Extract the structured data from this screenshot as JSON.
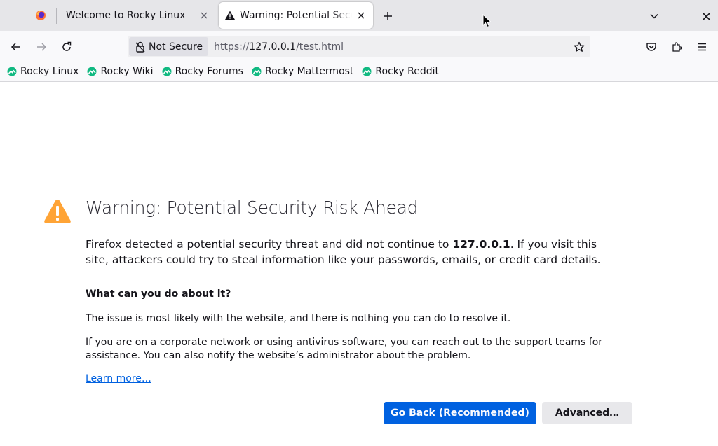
{
  "tabs": [
    {
      "label": "Welcome to Rocky Linux",
      "active": false
    },
    {
      "label": "Warning: Potential Security Risk Ahead",
      "active": true
    }
  ],
  "icons": {
    "firefox": "firefox-view-icon",
    "close": "close-icon",
    "new_tab": "plus-icon",
    "tab_list": "chevron-down-icon",
    "back": "back-arrow-icon",
    "forward": "forward-arrow-icon",
    "reload": "reload-icon",
    "lock": "broken-lock-icon",
    "star": "star-icon",
    "pocket": "pocket-icon",
    "extensions": "puzzle-icon",
    "menu": "hamburger-menu-icon",
    "warning": "warning-triangle-icon"
  },
  "urlbar": {
    "security_label": "Not Secure",
    "url_prefix": "https://",
    "url_host": "127.0.0.1",
    "url_path": "/test.html"
  },
  "bookmarks": [
    "Rocky Linux",
    "Rocky Wiki",
    "Rocky Forums",
    "Rocky Mattermost",
    "Rocky Reddit"
  ],
  "page": {
    "title": "Warning: Potential Security Risk Ahead",
    "desc_before": "Firefox detected a potential security threat and did not continue to ",
    "desc_host": "127.0.0.1",
    "desc_after": ". If you visit this site, attackers could try to steal information like your passwords, emails, or credit card details.",
    "subheading": "What can you do about it?",
    "para1": "The issue is most likely with the website, and there is nothing you can do to resolve it.",
    "para2": "If you are on a corporate network or using antivirus software, you can reach out to the support teams for assistance. You can also notify the website’s administrator about the problem.",
    "learn_more": "Learn more…",
    "go_back_button": "Go Back (Recommended)",
    "advanced_button": "Advanced…"
  },
  "colors": {
    "accent_blue": "#0061e0",
    "warning_orange": "#ffa436",
    "bookmark_green": "#10b981"
  }
}
